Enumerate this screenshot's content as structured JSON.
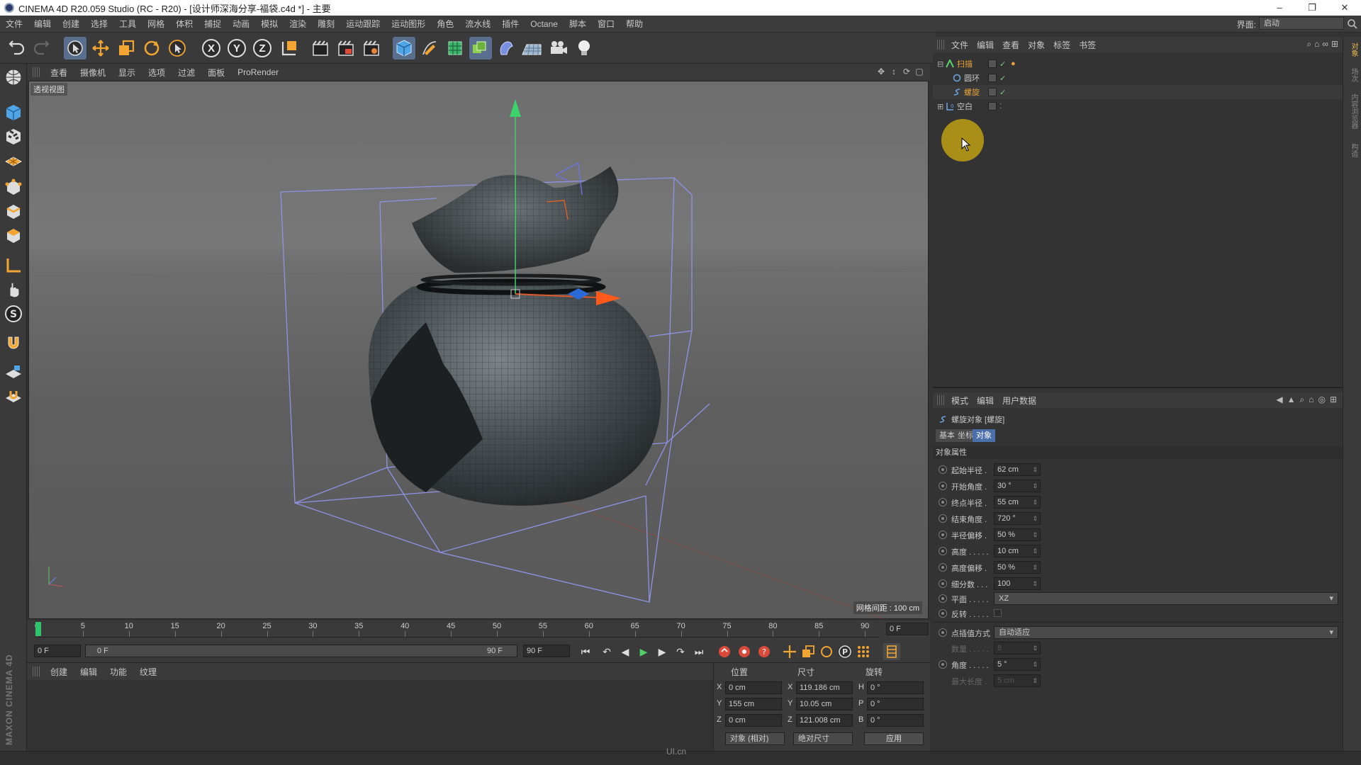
{
  "window": {
    "title": "CINEMA 4D R20.059 Studio (RC - R20) - [设计师深海分享-福袋.c4d *] - 主要",
    "controls": [
      "–",
      "❐",
      "✕"
    ]
  },
  "menubar": {
    "items": [
      "文件",
      "编辑",
      "创建",
      "选择",
      "工具",
      "网格",
      "体积",
      "捕捉",
      "动画",
      "模拟",
      "渲染",
      "雕刻",
      "运动跟踪",
      "运动图形",
      "角色",
      "流水线",
      "插件",
      "Octane",
      "脚本",
      "窗口",
      "帮助"
    ],
    "layout_label": "界面:",
    "layout_value": "启动"
  },
  "toolbar": {
    "icons": [
      "undo-icon",
      "redo-icon",
      "select-icon",
      "move-icon",
      "scale-icon",
      "rotate-icon",
      "live-select-icon",
      "x-axis-icon",
      "y-axis-icon",
      "z-axis-icon",
      "coordinate-system-icon",
      "render-view-icon",
      "render-picture-viewer-icon",
      "render-settings-icon",
      "cube-icon",
      "pen-icon",
      "subdivision-icon",
      "cloner-icon",
      "deformer-icon",
      "floor-icon",
      "camera-icon",
      "light-icon"
    ],
    "axis_labels": [
      "X",
      "Y",
      "Z"
    ]
  },
  "viewport": {
    "menu": [
      "查看",
      "摄像机",
      "显示",
      "选项",
      "过滤",
      "面板",
      "ProRender"
    ],
    "label": "透视视图",
    "grid_distance": "网格间距 : 100 cm"
  },
  "timeline": {
    "ticks": [
      "0",
      "5",
      "10",
      "15",
      "20",
      "25",
      "30",
      "35",
      "40",
      "45",
      "50",
      "55",
      "60",
      "65",
      "70",
      "75",
      "80",
      "85",
      "90"
    ],
    "current_frame": "0 F",
    "start_frame": "0 F",
    "range_start": "0 F",
    "range_end": "90 F",
    "end_frame": "90 F"
  },
  "materials": {
    "menu": [
      "创建",
      "编辑",
      "功能",
      "纹理"
    ]
  },
  "coordinates": {
    "headers": [
      "位置",
      "尺寸",
      "旋转"
    ],
    "position": {
      "x": "0 cm",
      "y": "155 cm",
      "z": "0 cm"
    },
    "size": {
      "x": "119.186 cm",
      "y": "10.05 cm",
      "z": "121.008 cm"
    },
    "rotation": {
      "h": "0 °",
      "p": "0 °",
      "b": "0 °"
    },
    "axes_pos": [
      "X",
      "Y",
      "Z"
    ],
    "axes_size": [
      "X",
      "Y",
      "Z"
    ],
    "axes_rot": [
      "H",
      "P",
      "B"
    ],
    "mode_dropdown": "对象 (相对)",
    "size_dropdown": "绝对尺寸",
    "apply_label": "应用"
  },
  "object_manager": {
    "menu": [
      "文件",
      "编辑",
      "查看",
      "对象",
      "标签",
      "书签"
    ],
    "active_menu": "对象",
    "objects": [
      {
        "name": "扫描",
        "level": 0,
        "highlight": true
      },
      {
        "name": "圆环",
        "level": 1,
        "highlight": false
      },
      {
        "name": "螺旋",
        "level": 1,
        "highlight": true
      },
      {
        "name": "空白",
        "level": 0,
        "highlight": false
      }
    ]
  },
  "attribute_manager": {
    "menu": [
      "模式",
      "编辑",
      "用户数据"
    ],
    "object_title": "螺旋对象 [螺旋]",
    "tabs": [
      "基本",
      "坐标",
      "对象"
    ],
    "active_tab": "对象",
    "section": "对象属性",
    "params": [
      {
        "label": "起始半径 .",
        "value": "62 cm"
      },
      {
        "label": "开始角度 .",
        "value": "30 °"
      },
      {
        "label": "终点半径 .",
        "value": "55 cm"
      },
      {
        "label": "结束角度 .",
        "value": "720 °"
      },
      {
        "label": "半径偏移 .",
        "value": "50 %"
      },
      {
        "label": "高度 . . . . .",
        "value": "10 cm"
      },
      {
        "label": "高度偏移 .",
        "value": "50 %"
      },
      {
        "label": "细分数 . . .",
        "value": "100"
      }
    ],
    "plane_label": "平面 . . . . .",
    "plane_value": "XZ",
    "reverse_label": "反转 . . . . .",
    "interp_label": "点插值方式",
    "interp_value": "自动适应",
    "number_label": "数量 . . . . .",
    "number_value": "8",
    "angle_label": "角度 . . . . .",
    "angle_value": "5 °",
    "maxlen_label": "最大长度 .",
    "maxlen_value": "5 cm"
  },
  "right_strip": [
    "对象",
    "场次",
    "内容浏览器",
    "构造"
  ],
  "branding": "MAXON CINEMA 4D",
  "watermark": "UI.cn",
  "colors": {
    "accent_orange": "#e9a33a",
    "active_tab_blue": "#4b6fa8",
    "timeline_cursor": "#2fc46b",
    "cursor_highlight": "#bea014"
  }
}
